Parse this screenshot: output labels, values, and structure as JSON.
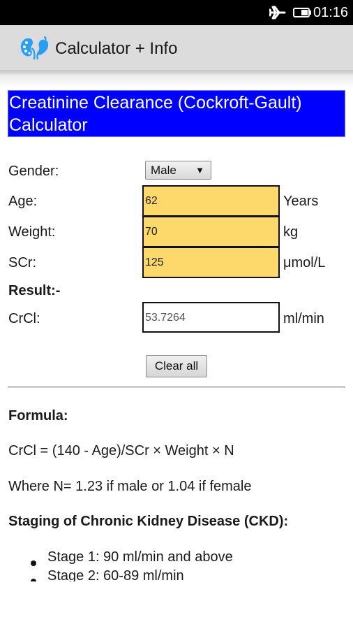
{
  "status_bar": {
    "time": "01:16",
    "icons": [
      "airplane-mode-icon",
      "battery-icon"
    ]
  },
  "action_bar": {
    "app_icon": "kidney-icon",
    "title": "Calculator + Info"
  },
  "calculator": {
    "heading": "Creatinine Clearance (Cockroft-Gault) Calculator",
    "colors": {
      "heading_bg": "#0000ff",
      "input_bg": "#fdd96b"
    },
    "gender": {
      "label": "Gender:",
      "selected": "Male",
      "arrow": "▼"
    },
    "age": {
      "label": "Age:",
      "value": "62",
      "unit": "Years"
    },
    "weight": {
      "label": "Weight:",
      "value": "70",
      "unit": "kg"
    },
    "scr": {
      "label": "SCr:",
      "value": "125",
      "unit": "μmol/L"
    },
    "result_heading": "Result:-",
    "crcl": {
      "label": "CrCl:",
      "value": "53.7264",
      "unit": "ml/min"
    },
    "clear_button": "Clear all"
  },
  "info": {
    "formula_heading": "Formula:",
    "formula": "CrCl = (140 - Age)/SCr × Weight × N",
    "where": "Where N= 1.23 if male or 1.04 if female",
    "staging_heading": "Staging of Chronic Kidney Disease (CKD):",
    "stages": [
      "Stage 1: 90 ml/min and above",
      "Stage 2: 60-89 ml/min"
    ]
  }
}
